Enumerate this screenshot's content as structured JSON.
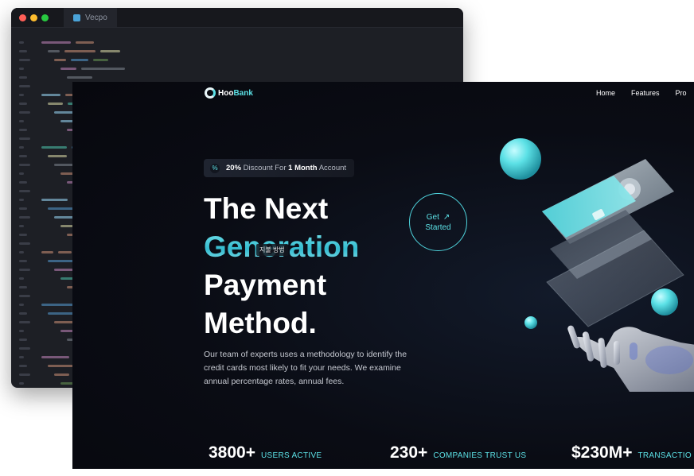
{
  "editor": {
    "tab_label": "Vecpo"
  },
  "site": {
    "logo": {
      "part1": "Hoo",
      "part2": "Bank"
    },
    "nav": [
      "Home",
      "Features",
      "Pro"
    ],
    "badge": {
      "prefix_bold": "20%",
      "middle": "Discount For",
      "mid_bold": "1 Month",
      "suffix": "Account"
    },
    "headline": {
      "line1": "The Next",
      "line2": "Generation",
      "line3": "Payment",
      "line4": "Method."
    },
    "tooltip": "지불 방법",
    "description": "Our team of experts uses a methodology to identify the credit cards most likely to fit your needs. We examine annual percentage rates, annual fees.",
    "cta": {
      "line1": "Get",
      "line2": "Started",
      "arrow": "↗"
    },
    "stats": [
      {
        "value": "3800+",
        "label": "USERS ACTIVE"
      },
      {
        "value": "230+",
        "label": "COMPANIES TRUST US"
      },
      {
        "value": "$230M+",
        "label": "TRANSACTIO"
      }
    ],
    "colors": {
      "accent": "#5ce1e6",
      "background": "#07080e"
    }
  }
}
